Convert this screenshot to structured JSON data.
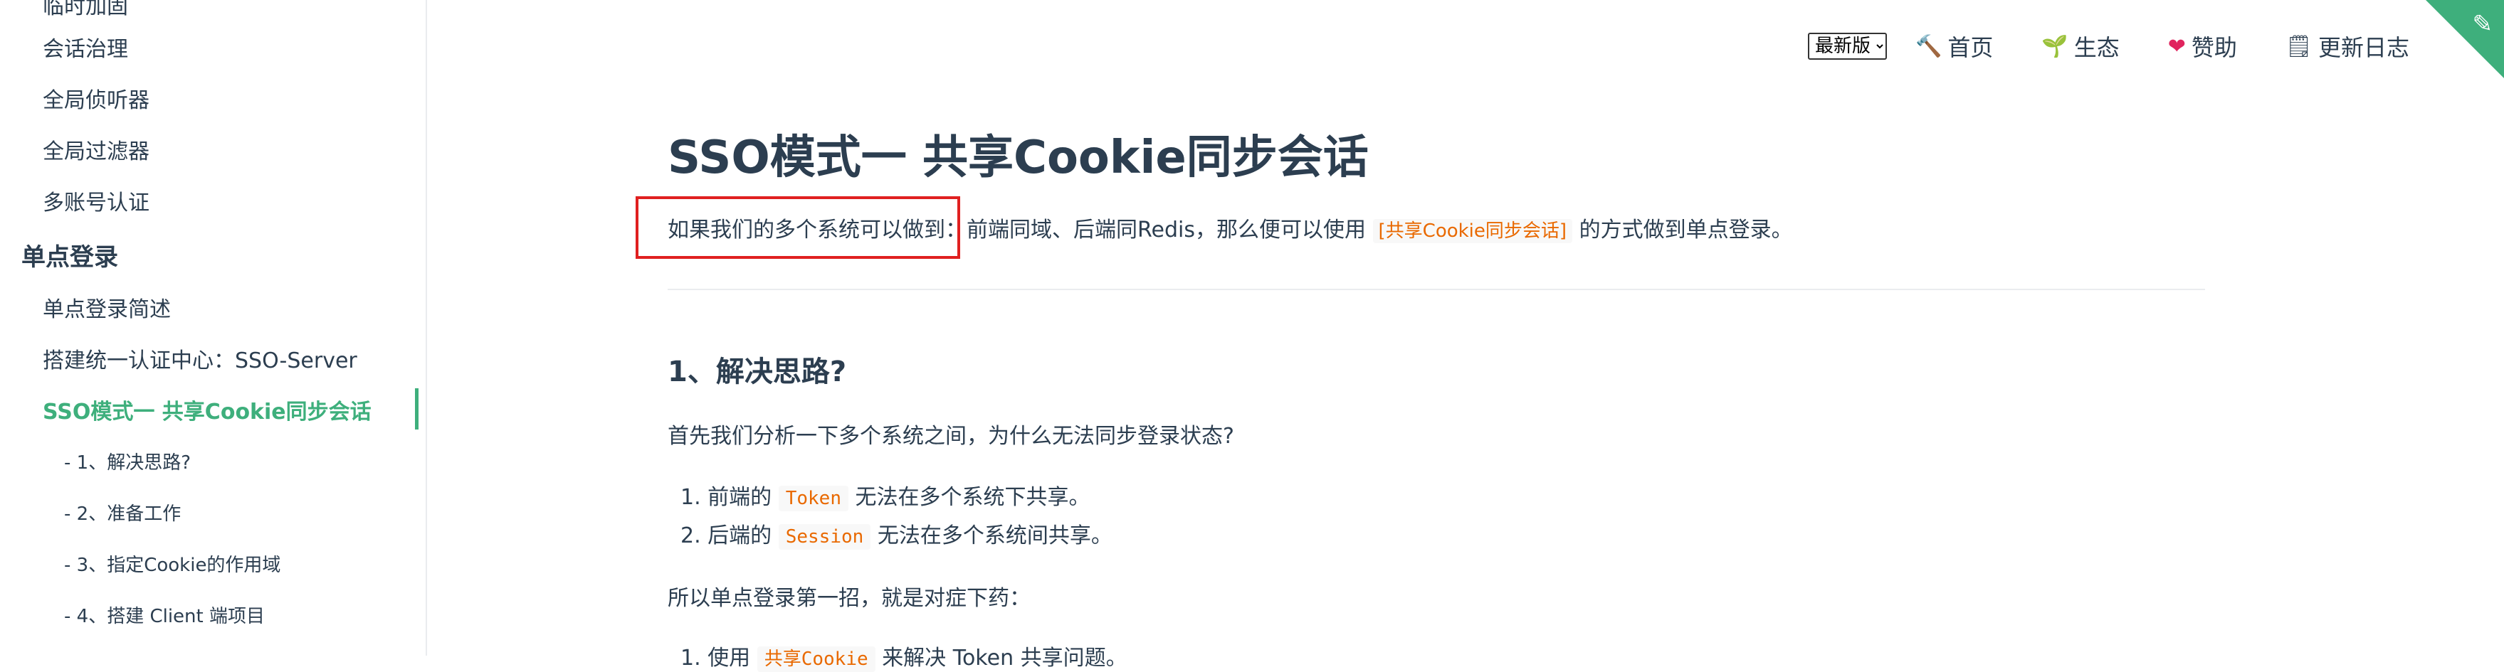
{
  "sidebar": {
    "partial_top": "临时加固",
    "items_before": [
      "会话治理",
      "全局侦听器",
      "全局过滤器",
      "多账号认证"
    ],
    "section": "单点登录",
    "items_after": [
      "单点登录简述",
      "搭建统一认证中心：SSO-Server"
    ],
    "active": "SSO模式一 共享Cookie同步会话",
    "sub_items": [
      "- 1、解决思路?",
      "- 2、准备工作",
      "- 3、指定Cookie的作用域",
      "- 4、搭建 Client 端项目"
    ]
  },
  "nav": {
    "version_selected": "最新版",
    "items": [
      {
        "icon": "hammer-icon",
        "glyph": "🔨",
        "label": "首页"
      },
      {
        "icon": "seedling-icon",
        "glyph": "🌱",
        "label": "生态"
      },
      {
        "icon": "heart-icon",
        "glyph": "❤",
        "label": "赞助"
      },
      {
        "icon": "notepad-icon",
        "glyph": "🗒",
        "label": "更新日志"
      }
    ]
  },
  "content": {
    "title": "SSO模式一 共享Cookie同步会话",
    "intro_part1": "如果我们的多个系统可以做到：",
    "intro_part2": "前端同域、后端同Redis，那么便可以使用",
    "intro_code": "[共享Cookie同步会话]",
    "intro_part3": "的方式做到单点登录。",
    "section1_title": "1、解决思路?",
    "para1": "首先我们分析一下多个系统之间，为什么无法同步登录状态?",
    "list": [
      {
        "prefix": "1. 前端的",
        "code": "Token",
        "suffix": "无法在多个系统下共享。"
      },
      {
        "prefix": "2. 后端的",
        "code": "Session",
        "suffix": "无法在多个系统间共享。"
      }
    ],
    "para2": "所以单点登录第一招，就是对症下药：",
    "partial_list": {
      "prefix": "1. 使用",
      "code": "共享Cookie",
      "suffix": "来解决 Token 共享问题。"
    }
  },
  "colors": {
    "accent": "#3eaf7c",
    "code": "#e96900",
    "highlight": "#e02020",
    "text": "#2c3e50"
  }
}
